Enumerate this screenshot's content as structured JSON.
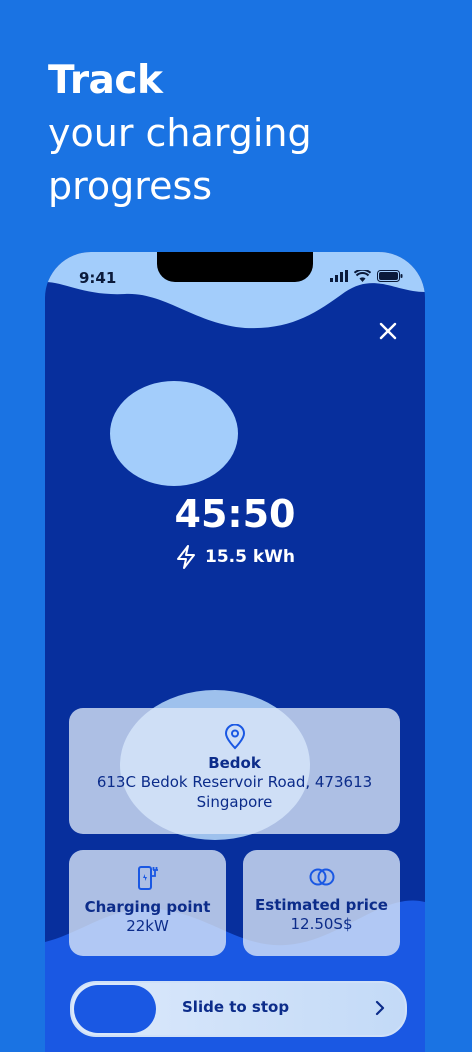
{
  "headline": {
    "line1": "Track",
    "line2": "your charging",
    "line3": "progress"
  },
  "status_bar": {
    "time": "9:41"
  },
  "session": {
    "timer": "45:50",
    "energy": "15.5 kWh"
  },
  "location": {
    "name": "Bedok",
    "address_line1": "613C Bedok Reservoir Road, 473613",
    "address_line2": "Singapore"
  },
  "charging_point": {
    "label": "Charging point",
    "value": "22kW"
  },
  "estimated_price": {
    "label": "Estimated price",
    "value": "12.50S$"
  },
  "slider": {
    "label": "Slide to stop"
  },
  "colors": {
    "background": "#1a73e3",
    "phone_background": "#072f9d",
    "accent": "#1a58e3",
    "card_text": "#0c2c8a"
  }
}
